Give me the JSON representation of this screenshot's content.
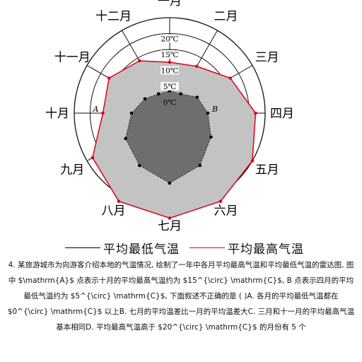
{
  "chart_data": {
    "type": "radar",
    "categories": [
      "一月",
      "二月",
      "三月",
      "四月",
      "五月",
      "六月",
      "七月",
      "八月",
      "九月",
      "十月",
      "十一月",
      "十二月"
    ],
    "radial_ticks": [
      "20℃",
      "15℃",
      "10℃",
      "5℃",
      "0℃"
    ],
    "radial_tick_values": [
      20,
      15,
      10,
      5,
      0
    ],
    "radial_range": [
      -5,
      25
    ],
    "grid": true,
    "series": [
      {
        "name": "平均最低气温",
        "color": "#000000",
        "values": [
          2,
          2,
          5,
          7,
          10,
          14,
          17,
          14,
          11,
          7,
          4,
          2
        ]
      },
      {
        "name": "平均最高气温",
        "color": "#e0001a",
        "values": [
          11,
          12,
          17,
          22,
          25,
          27,
          28,
          27,
          23,
          16,
          17,
          14
        ]
      }
    ],
    "annotations": [
      {
        "text": "A",
        "series": "平均最高气温",
        "category": "十月"
      },
      {
        "text": "B",
        "series": "平均最低气温",
        "category": "四月"
      }
    ],
    "legend_position": "bottom",
    "colors": {
      "inner_fill": "#6e6e6e",
      "outer_fill": "#c3c3c3",
      "grid": "#111111"
    }
  },
  "question": {
    "text": "4. 某旅游城市为向游客介绍本地的气温情况, 绘制了一年中各月平均最高气温和平均最低气温的雷达图, 图中 $\\mathrm{A}$ 点表示十月的平均最高气温约为 $15^{\\circ} \\mathrm{C}$, B 点表示四月的平均最低气温约为 $5^{\\circ} \\mathrm{C}$, 下面叙述不正确的是 ( )A. 各月的平均最低气温都在 $0^{\\circ} \\mathrm{C}$ 以上B. 七月的平均温差比一月的平均温差大C. 三月和十一月的平均最高气温基本相同D. 平均最高气温高于 $20^{\\circ} \\mathrm{C}$ 的月份有 5 个"
  }
}
